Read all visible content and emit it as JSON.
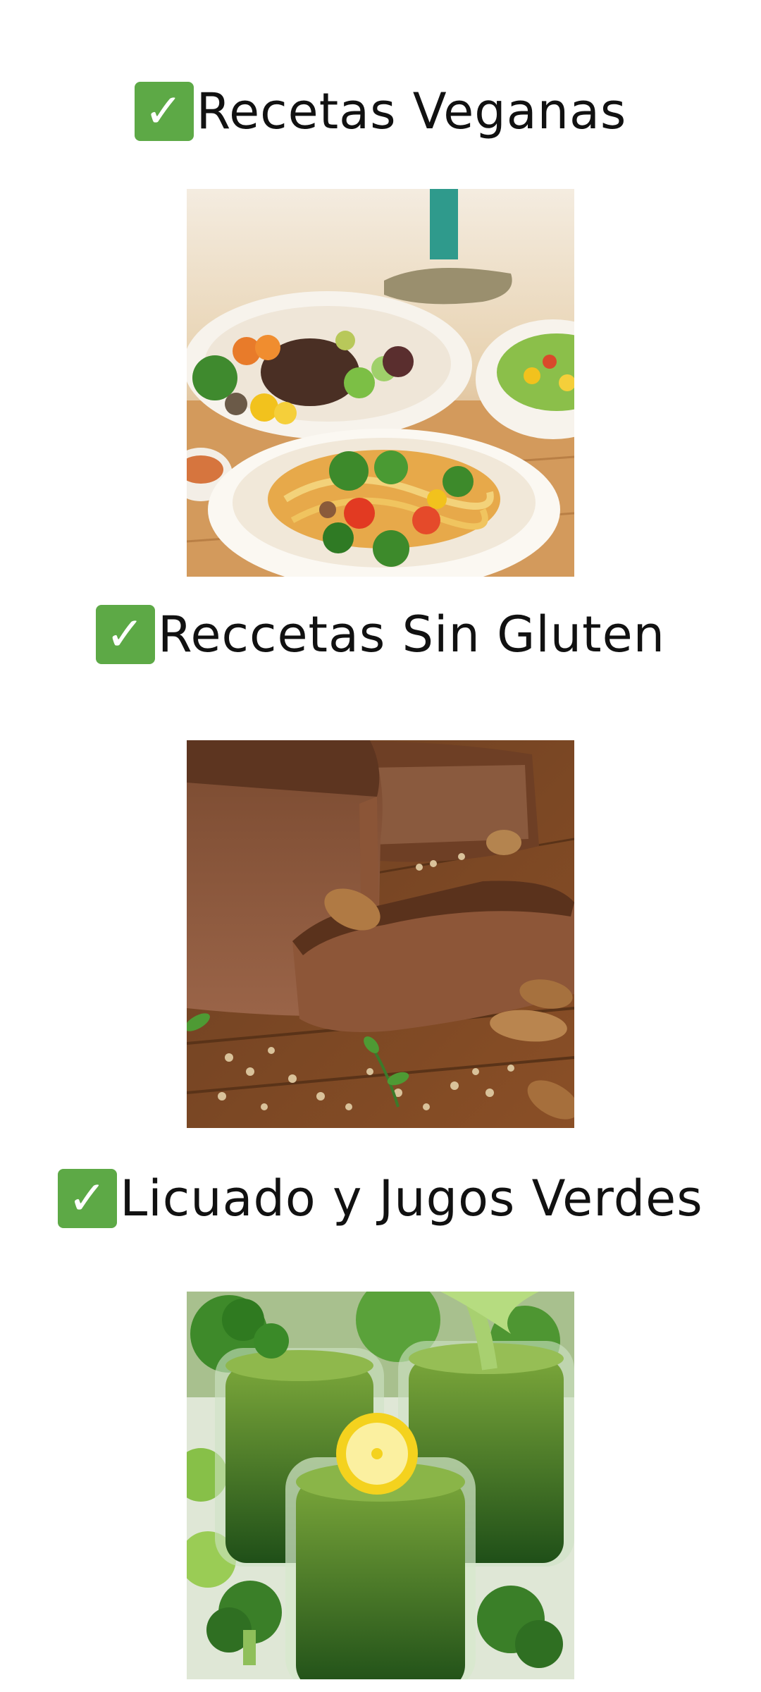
{
  "sections": [
    {
      "title": "Recetas Veganas",
      "check_icon": "✓",
      "image": "vegan-bowls-photo"
    },
    {
      "title": "Reccetas Sin Gluten",
      "check_icon": "✓",
      "image": "gluten-free-bread-photo"
    },
    {
      "title": "Licuado y Jugos Verdes",
      "check_icon": "✓",
      "image": "green-juices-photo"
    }
  ],
  "colors": {
    "check_green": "#5da946",
    "text": "#111111",
    "background": "#ffffff"
  }
}
